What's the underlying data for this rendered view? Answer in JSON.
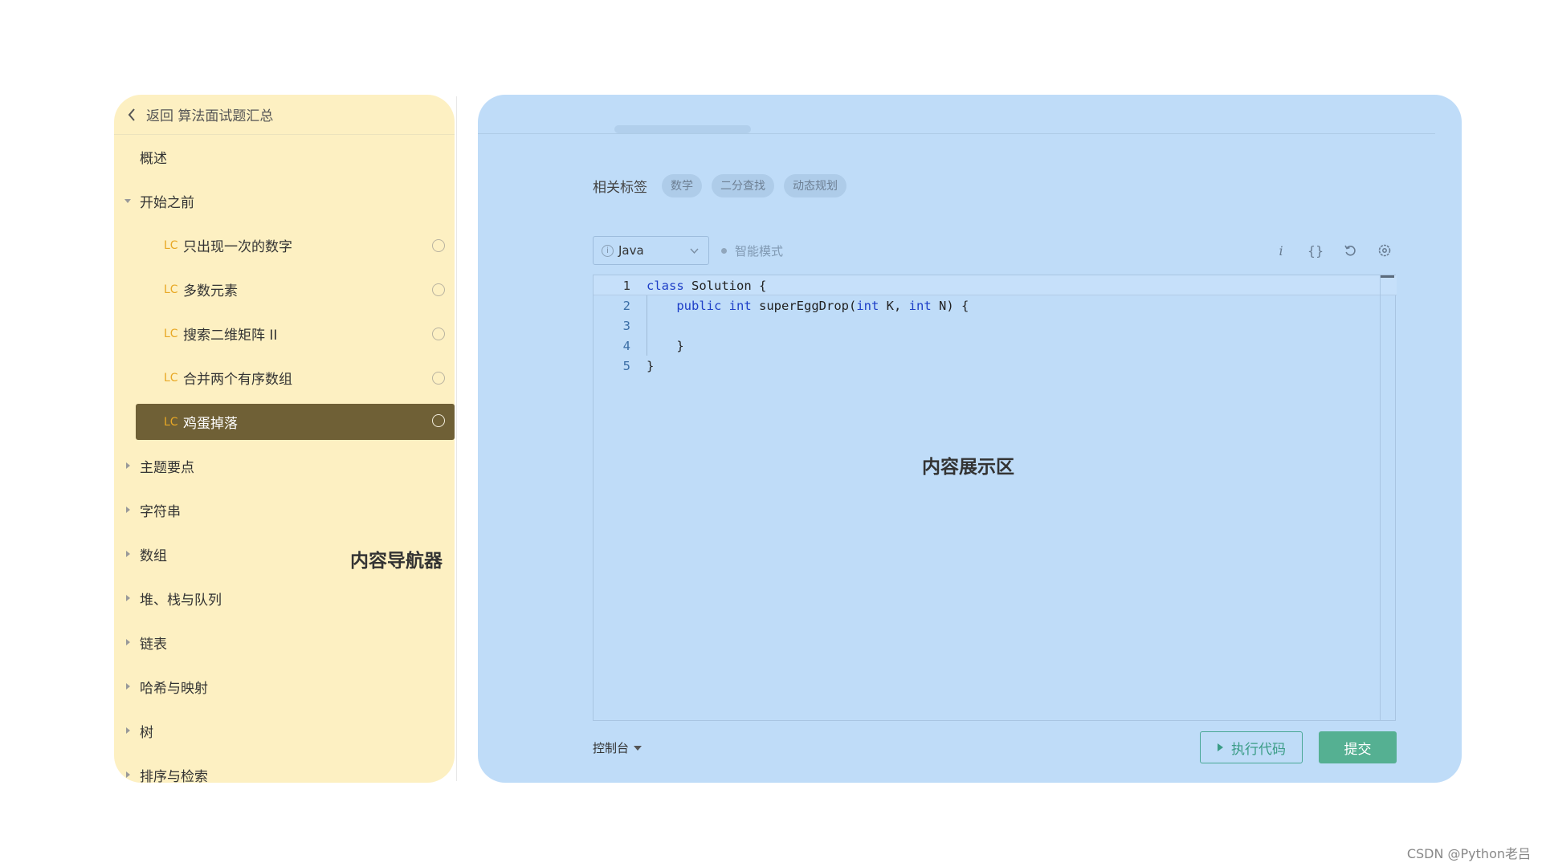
{
  "sidebar": {
    "back_link": "返回 算法面试题汇总",
    "overlay_label": "内容导航器",
    "badge": "LC",
    "items": [
      {
        "label": "概述",
        "type": "plain"
      },
      {
        "label": "开始之前",
        "type": "group",
        "expanded": true
      },
      {
        "label": "只出现一次的数字",
        "type": "problem"
      },
      {
        "label": "多数元素",
        "type": "problem"
      },
      {
        "label": "搜索二维矩阵 II",
        "type": "problem"
      },
      {
        "label": "合并两个有序数组",
        "type": "problem"
      },
      {
        "label": "鸡蛋掉落",
        "type": "problem",
        "active": true
      },
      {
        "label": "主题要点",
        "type": "group",
        "expanded": false
      },
      {
        "label": "字符串",
        "type": "group",
        "expanded": false
      },
      {
        "label": "数组",
        "type": "group",
        "expanded": false
      },
      {
        "label": "堆、栈与队列",
        "type": "group",
        "expanded": false
      },
      {
        "label": "链表",
        "type": "group",
        "expanded": false
      },
      {
        "label": "哈希与映射",
        "type": "group",
        "expanded": false
      },
      {
        "label": "树",
        "type": "group",
        "expanded": false
      },
      {
        "label": "排序与检索",
        "type": "group",
        "expanded": false
      }
    ]
  },
  "content": {
    "overlay_label": "内容展示区",
    "tags_label": "相关标签",
    "tags": [
      "数学",
      "二分查找",
      "动态规划"
    ],
    "language": "Java",
    "smart_mode": "智能模式",
    "tool_icons": [
      "info-icon",
      "braces-icon",
      "reset-icon",
      "settings-icon"
    ],
    "code": {
      "line_numbers": [
        "1",
        "2",
        "3",
        "4",
        "5"
      ],
      "l1_kw": "class",
      "l1_rest": " Solution {",
      "l2_kw1": "public",
      "l2_kw2": "int",
      "l2_mid": " superEggDrop(",
      "l2_kw3": "int",
      "l2_mid2": " K, ",
      "l2_kw4": "int",
      "l2_end": " N) {",
      "l4": "    }",
      "l5": "}"
    },
    "console_label": "控制台",
    "run_label": "执行代码",
    "submit_label": "提交"
  },
  "watermark": "CSDN @Python老吕",
  "colors": {
    "nav_bg": "#fdf0c2",
    "content_bg": "#bfdcf8",
    "active_item": "#6f6036",
    "accent_green": "#55b092",
    "badge": "#e8a825"
  }
}
